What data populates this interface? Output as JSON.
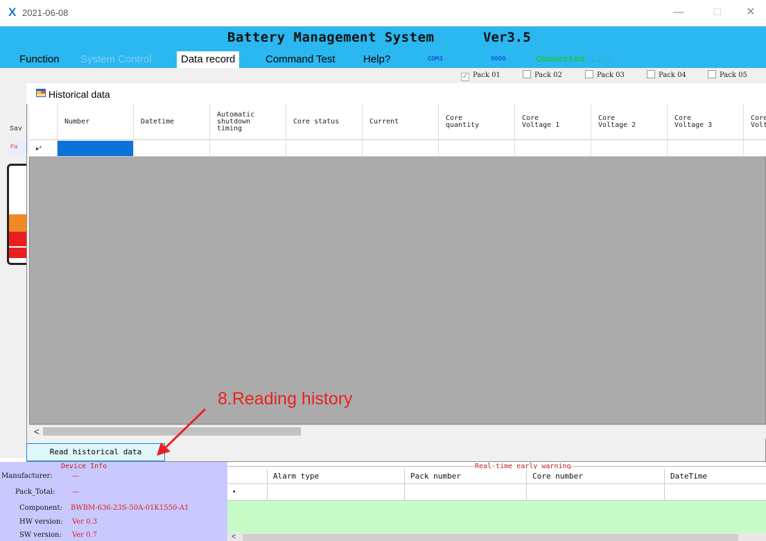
{
  "window": {
    "title": "2021-06-08",
    "minimize": "—",
    "maximize": "□",
    "close": "✕"
  },
  "banner": {
    "title": "Battery Management System",
    "version": "Ver3.5"
  },
  "menu": [
    {
      "label": "Function",
      "state": "normal"
    },
    {
      "label": "System Control",
      "state": "disabled"
    },
    {
      "label": "Data record",
      "state": "active"
    },
    {
      "label": "Command Test",
      "state": "normal"
    },
    {
      "label": "Help?",
      "state": "normal"
    }
  ],
  "connection": {
    "port": "COM3",
    "baud": "9600",
    "status": "Connected....."
  },
  "packs": [
    {
      "label": "Pack 01",
      "checked": true
    },
    {
      "label": "Pack 02",
      "checked": false
    },
    {
      "label": "Pack 03",
      "checked": false
    },
    {
      "label": "Pack 04",
      "checked": false
    },
    {
      "label": "Pack 05",
      "checked": false
    }
  ],
  "background": {
    "sav_label": "Sav",
    "pa_label": "Pa"
  },
  "historical": {
    "title": "Historical data",
    "columns": [
      "Number",
      "Datetime",
      "Automatic\nshutdown\ntiming",
      "Core status",
      "Current",
      "Core\nquantity",
      "Core\nVoltage 1",
      "Core\nVoltage 2",
      "Core\nVoltage 3",
      "Core\nVolt"
    ],
    "new_row_indicator": "▸*",
    "scroll_left": "<",
    "read_button": "Read historical data"
  },
  "annotation": {
    "text": "8.Reading history",
    "color": "#e8231f"
  },
  "device_info": {
    "title": "Device Info",
    "fields": [
      {
        "label": "Manufacturer:",
        "value": "—"
      },
      {
        "label": "Pack_Total:",
        "value": "—"
      },
      {
        "label": "Component:",
        "value": "BWBM-636-23S-50A-01K1550-A1"
      },
      {
        "label": "HW version:",
        "value": "Ver 0.3"
      },
      {
        "label": "SW version:",
        "value": "Ver 0.7"
      }
    ]
  },
  "warning": {
    "title": "Real-time early warning",
    "columns": [
      "Alarm type",
      "Pack number",
      "Core number",
      "DateTime"
    ],
    "new_row_indicator": "•",
    "scroll_left": "<"
  },
  "colors": {
    "banner": "#2bb7ef",
    "selection": "#0a73d9",
    "device_panel": "#c9c9ff",
    "warning_panel": "#c6fbc6",
    "connected": "#22c244"
  }
}
